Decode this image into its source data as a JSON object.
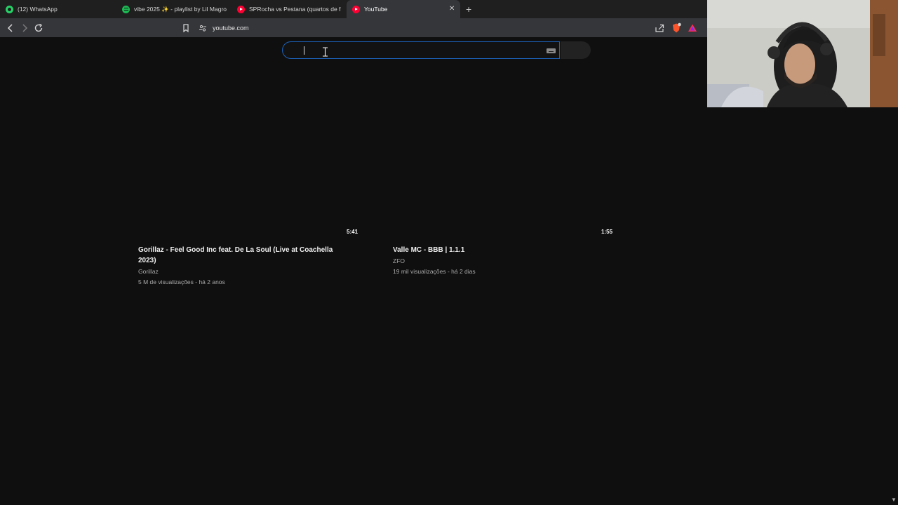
{
  "browser": {
    "tabs": [
      {
        "title": "(12) WhatsApp",
        "icon": "whatsapp-icon"
      },
      {
        "title": "vibe 2025 ✨ - playlist by Lil Magro |",
        "icon": "spotify-icon"
      },
      {
        "title": "SPRocha vs Pestana (quartos de final",
        "icon": "youtube-icon"
      },
      {
        "title": "YouTube",
        "icon": "youtube-icon",
        "active": true
      }
    ],
    "new_tab_label": "+",
    "close_tab_label": "✕",
    "url": "youtube.com"
  },
  "search": {
    "value": "",
    "placeholder": ""
  },
  "videos": [
    {
      "duration": "5:41",
      "title": "Gorillaz - Feel Good Inc feat. De La Soul (Live at Coachella 2023)",
      "channel": "Gorillaz",
      "meta": "5 M de visualizações - há 2 anos"
    },
    {
      "duration": "1:55",
      "title": "Valle MC - BBB | 1.1.1",
      "channel": "ZFO",
      "meta": "19 mil visualizações - há 2 dias"
    }
  ],
  "colors": {
    "page_bg": "#0f0f0f",
    "search_focus_border": "#1c62b9",
    "youtube_red": "#ff0033"
  }
}
